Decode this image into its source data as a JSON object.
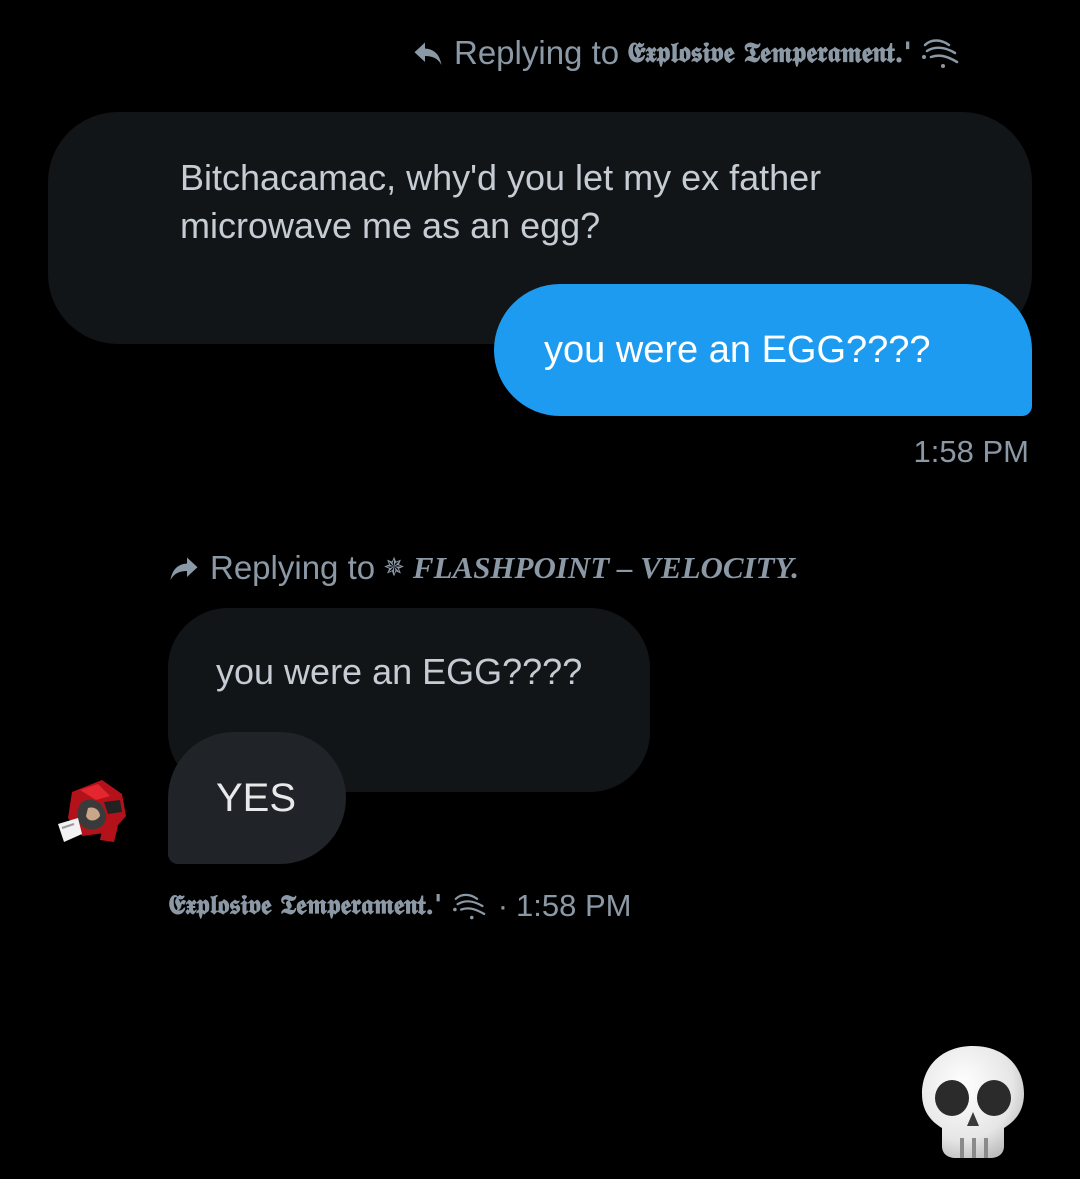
{
  "thread": {
    "first_reply_context": {
      "prefix": "Replying to",
      "name": "𝕰𝖝𝖕𝖑𝖔𝖘𝖎𝖛𝖊 𝕿𝖊𝖒𝖕𝖊𝖗𝖆𝖒𝖊𝖓𝖙.'",
      "icon": "reply-arrow-icon"
    },
    "quoted_message": "Bitchacamac, why'd you let my ex father\nmicrowave me as an egg?",
    "sent_message": "you were an EGG????",
    "sent_time": "1:58 PM",
    "second_reply_context": {
      "prefix": "Replying to",
      "symbol": "✵",
      "name": "FLASHPOINT – VELOCITY.",
      "icon": "forward-arrow-icon"
    },
    "quoted_reply": "you were an EGG????",
    "received_message": "YES",
    "received_meta": {
      "sender": "𝕰𝖝𝖕𝖑𝖔𝖘𝖎𝖛𝖊 𝕿𝖊𝖒𝖕𝖊𝖗𝖆𝖒𝖊𝖓𝖙.'",
      "separator": "·",
      "time": "1:58 PM"
    },
    "reaction_emoji": "skull-emoji"
  },
  "colors": {
    "background": "#000000",
    "sent_bubble": "#1d9bf0",
    "received_bubble": "#202327",
    "quoted_bubble": "#121518",
    "muted_text": "#8b98a5"
  }
}
